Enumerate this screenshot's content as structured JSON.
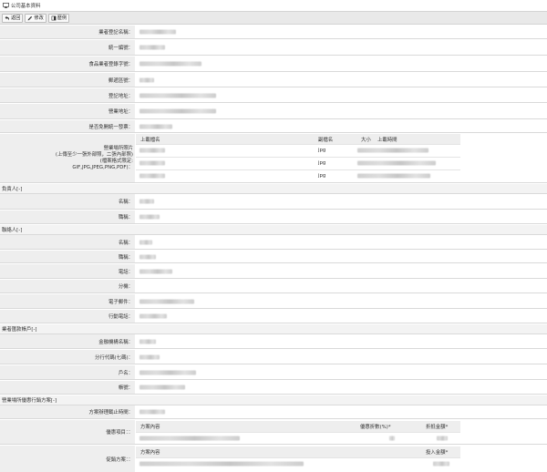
{
  "window": {
    "title": "公司基本資料",
    "icon": "monitor-icon"
  },
  "toolbar": {
    "back_label": "返回",
    "edit_label": "修改",
    "history_label": "歷例"
  },
  "basic": {
    "reg_name": "業者登記名稱：",
    "unified_no": "統一編號：",
    "food_reg_no": "食品業者登錄字號：",
    "postal": "郵遞區號：",
    "reg_address": "登記地址：",
    "biz_address": "營業地址：",
    "invoice": "是否免開統一發票："
  },
  "photo": {
    "label_line1": "營業場所照片",
    "label_line2": "(上傳至少一張外部照，二張內部照)",
    "label_line3": "(檔案格式限定:",
    "label_line4": "GIF,JPG,JPEG,PNG,PDF)：",
    "col_name": "上載檔名",
    "col_ext": "副檔名",
    "col_size": "大小",
    "col_time": "上載時間",
    "rows": [
      {
        "ext": "jpg"
      },
      {
        "ext": "jpg"
      },
      {
        "ext": "jpg"
      }
    ]
  },
  "responsible": {
    "section": "負責人[-]",
    "name": "名稱：",
    "title": "職稱："
  },
  "contact": {
    "section": "聯絡人[-]",
    "name": "名稱：",
    "title": "職稱：",
    "phone": "電話：",
    "ext": "分機：",
    "email": "電子郵件：",
    "mobile": "行動電話："
  },
  "bank": {
    "section": "業者匯款帳戶[-]",
    "bank_name": "金融機構名稱：",
    "branch_code": "分行代碼(七碼)：",
    "account_name": "戶名：",
    "account_no": "帳號："
  },
  "promo": {
    "section": "營業場所優惠行銷方案[-]",
    "deadline": "方案辦理截止時間：",
    "discount_label": "優惠項目：：",
    "discount_col_content": "方案內容",
    "discount_col_rate": "優惠折數(%)*",
    "discount_col_amount": "折抵金額*",
    "promo_label": "促銷方案：：",
    "promo_col_content": "方案內容",
    "promo_col_amount": "投入金額*"
  }
}
